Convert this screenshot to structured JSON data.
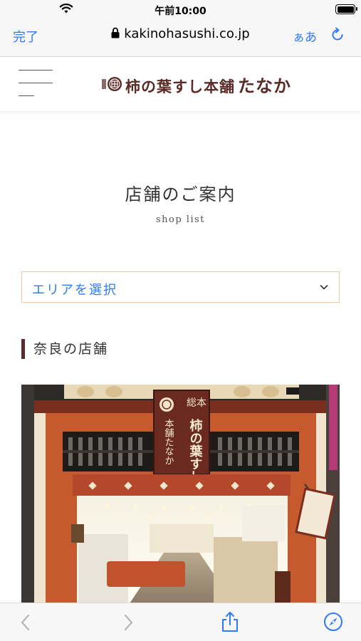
{
  "status_bar": {
    "time": "午前10:00"
  },
  "browser": {
    "done_label": "完了",
    "url": "kakinohasushi.co.jp",
    "text_size_label": "ぁあ"
  },
  "site": {
    "logo_small": "総本",
    "logo_text": "柿の葉すし本舗",
    "logo_name": "たなか"
  },
  "page": {
    "title": "店舗のご案内",
    "subtitle": "shop list",
    "area_select": "エリアを選択",
    "section_heading": "奈良の店舗",
    "sign_vertical_1": "柿の葉すし",
    "sign_vertical_2": "本舗たなか"
  },
  "colors": {
    "accent": "#2f7bf5",
    "brand": "#5a2a26",
    "select_border": "#f0c8a6"
  }
}
